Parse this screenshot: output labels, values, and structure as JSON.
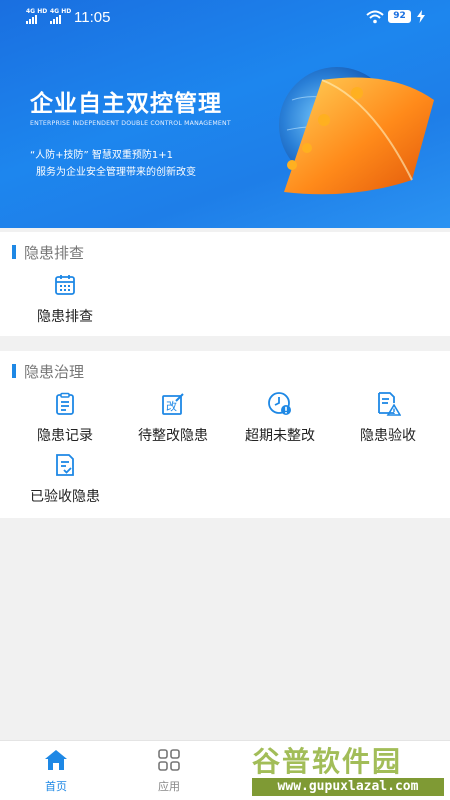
{
  "status_bar": {
    "time": "11:05",
    "network1": "4G HD",
    "network2": "4G HD",
    "battery": "92"
  },
  "banner": {
    "title": "企业自主双控管理",
    "subtitle_en": "ENTERPRISE INDEPENDENT DOUBLE CONTROL MANAGEMENT",
    "line1": "“人防+技防” 智慧双重预防1+1",
    "line2": "服务为企业安全管理带来的创新改变"
  },
  "sections": [
    {
      "title": "隐患排查",
      "items": [
        {
          "label": "隐患排查",
          "icon": "calendar-icon"
        }
      ]
    },
    {
      "title": "隐患治理",
      "items": [
        {
          "label": "隐患记录",
          "icon": "clipboard-icon"
        },
        {
          "label": "待整改隐患",
          "icon": "edit-icon"
        },
        {
          "label": "超期未整改",
          "icon": "clock-alert-icon"
        },
        {
          "label": "隐患验收",
          "icon": "document-warning-icon"
        },
        {
          "label": "已验收隐患",
          "icon": "document-check-icon"
        }
      ]
    }
  ],
  "bottom_nav": {
    "tabs": [
      {
        "label": "首页",
        "icon": "home-icon",
        "active": true
      },
      {
        "label": "应用",
        "icon": "grid-icon",
        "active": false
      }
    ]
  },
  "watermark": {
    "text": "谷普软件园",
    "url": "www.gupuxlazal.com"
  },
  "colors": {
    "accent": "#1e88e5",
    "banner": "#1a6fe0"
  }
}
